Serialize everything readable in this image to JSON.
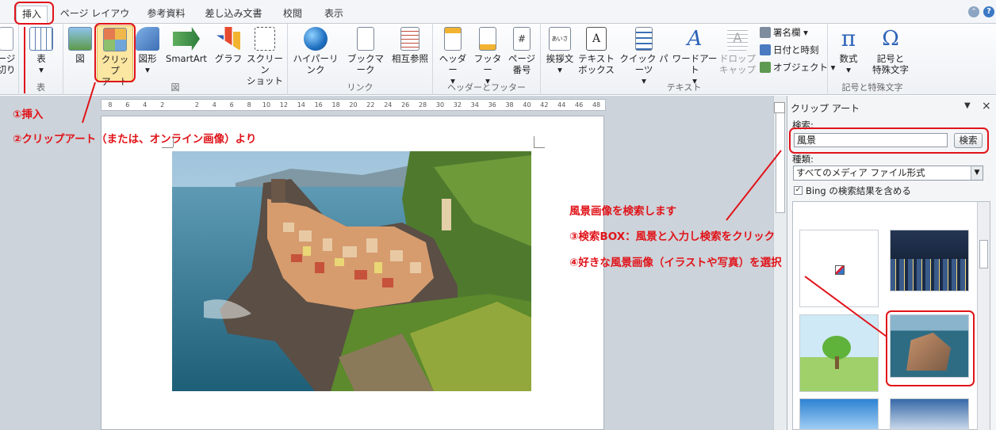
{
  "ribbon": {
    "tabs": [
      "挿入",
      "ページ レイアウト",
      "参考資料",
      "差し込み文書",
      "校閲",
      "表示"
    ],
    "groups": {
      "table": "表",
      "illustrations": "図",
      "links": "リンク",
      "header_footer": "ヘッダーとフッター",
      "text": "テキスト",
      "symbols": "記号と特殊文字"
    },
    "buttons": {
      "page_break_1": "ージ",
      "page_break_2": "切り",
      "table": "表",
      "picture": "図",
      "clipart_1": "クリップ",
      "clipart_2": "アート",
      "shapes": "図形",
      "smartart": "SmartArt",
      "chart": "グラフ",
      "screenshot_1": "スクリーン",
      "screenshot_2": "ショット",
      "hyperlink": "ハイパーリンク",
      "bookmark": "ブックマーク",
      "crossref": "相互参照",
      "header": "ヘッダー",
      "footer": "フッター",
      "pagenum_1": "ページ",
      "pagenum_2": "番号",
      "greeting": "挨拶文",
      "textbox_1": "テキスト",
      "textbox_2": "ボックス",
      "quickparts": "クイック パーツ",
      "wordart": "ワードアート",
      "dropcap_1": "ドロップ",
      "dropcap_2": "キャップ",
      "signature": "署名欄",
      "datetime": "日付と時刻",
      "object": "オブジェクト",
      "equation": "数式",
      "symbol_1": "記号と",
      "symbol_2": "特殊文字",
      "greeting_icon_text": "あいさつ",
      "dropdown_arrow": "▾"
    }
  },
  "ruler": {
    "ticks": [
      "8",
      "6",
      "4",
      "2",
      "",
      "2",
      "4",
      "6",
      "8",
      "10",
      "12",
      "14",
      "16",
      "18",
      "20",
      "22",
      "24",
      "26",
      "28",
      "30",
      "32",
      "34",
      "36",
      "38",
      "40",
      "42",
      "44",
      "46",
      "48"
    ]
  },
  "pane": {
    "title": "クリップ アート",
    "search_label": "検索:",
    "search_value": "風景",
    "search_button": "検索",
    "type_label": "種類:",
    "type_value": "すべてのメディア ファイル形式",
    "bing_label": "Bing の検索結果を含める",
    "close": "×",
    "menu": "▼"
  },
  "annotations": {
    "step1": "①挿入",
    "step2": "②クリップアート（または、オンライン画像）より",
    "intro": "風景画像を検索します",
    "step3": "③検索BOX：風景と入力し検索をクリック",
    "step4": "④好きな風景画像（イラストや写真）を選択"
  },
  "colors": {
    "annotation": "#e0141a",
    "ribbon_bg": "#f3f5f8",
    "workspace": "#cdd3da"
  }
}
